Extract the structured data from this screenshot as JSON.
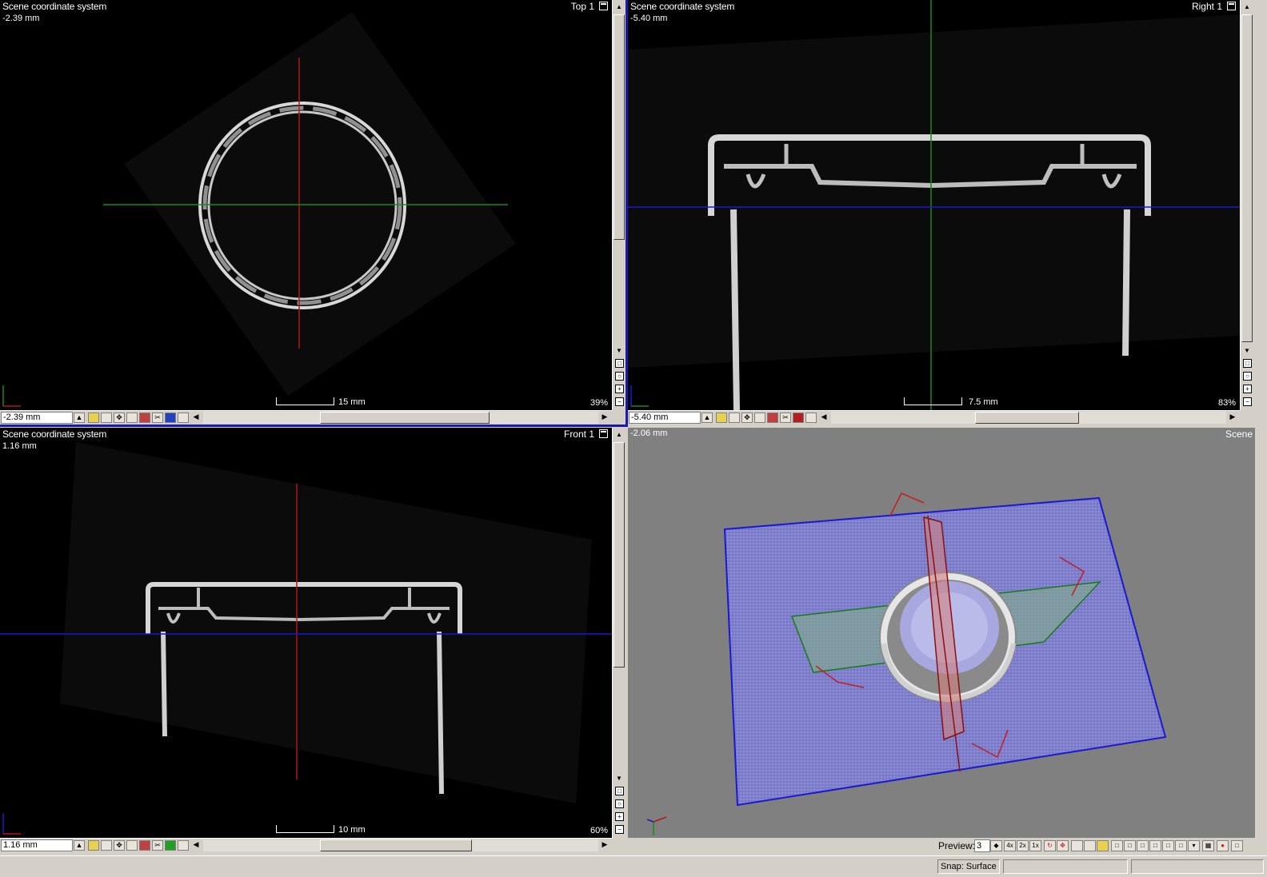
{
  "viewports": {
    "top": {
      "coord_system": "Scene coordinate system",
      "position": "-2.39 mm",
      "name": "Top 1",
      "scale": "15 mm",
      "zoom": "39%",
      "field_value": "-2.39 mm"
    },
    "right": {
      "coord_system": "Scene coordinate system",
      "position": "-5.40 mm",
      "name": "Right 1",
      "scale": "7.5 mm",
      "zoom": "83%",
      "field_value": "-5.40 mm"
    },
    "front": {
      "coord_system": "Scene coordinate system",
      "position": "1.16 mm",
      "name": "Front 1",
      "scale": "10 mm",
      "zoom": "60%",
      "field_value": "1.16 mm"
    },
    "scene": {
      "position": "-2.06 mm",
      "name": "Scene"
    }
  },
  "scene_toolbar": {
    "preview_label": "Preview:",
    "preview_value": "3",
    "btn_4x": "4x",
    "btn_2x": "2x",
    "btn_1x": "1x"
  },
  "status": {
    "panel_text": "Snap: Surface"
  },
  "axis_labels": {
    "x": "x",
    "y": "y",
    "z": "z"
  },
  "colors": {
    "crosshair_red": "#b01818",
    "crosshair_green": "#1a8a1a",
    "crosshair_blue": "#1a1acd",
    "frame_blue": "#1a1aa8",
    "plane_blue": "#6a6acd",
    "plane_green": "#2a9a2a"
  }
}
